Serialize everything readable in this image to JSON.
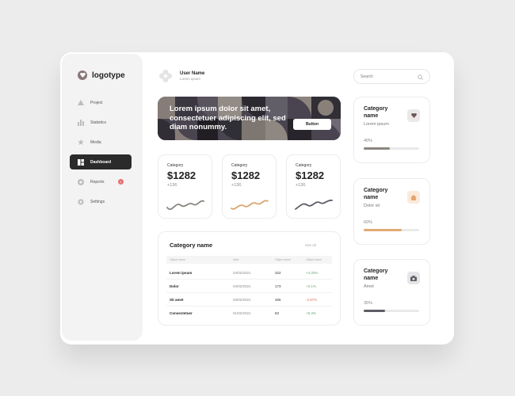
{
  "brand": {
    "logo_text": "logotype"
  },
  "sidebar": {
    "items": [
      {
        "label": "Project",
        "icon": "triangle-icon"
      },
      {
        "label": "Statistics",
        "icon": "bar-chart-icon"
      },
      {
        "label": "Media",
        "icon": "star-icon"
      },
      {
        "label": "Dashboard",
        "icon": "dashboard-icon",
        "active": true
      },
      {
        "label": "Reports",
        "icon": "circle-icon",
        "badge": "1"
      },
      {
        "label": "Settings",
        "icon": "gear-icon"
      }
    ]
  },
  "header": {
    "user_name": "User Name",
    "user_sub": "Lorem ipsum",
    "search_placeholder": "Search"
  },
  "banner": {
    "text": "Lorem ipsum dolor sit amet, consectetuer adipiscing elit, sed diam nonummy.",
    "button_label": "Button"
  },
  "stats": [
    {
      "category": "Category",
      "value": "$1282",
      "delta": "+136",
      "color": "#8a857e"
    },
    {
      "category": "Category",
      "value": "$1282",
      "delta": "+136",
      "color": "#d9a66f"
    },
    {
      "category": "Category",
      "value": "$1282",
      "delta": "+136",
      "color": "#5f5c66"
    }
  ],
  "table": {
    "title": "Category name",
    "see_all": "See all",
    "headers": [
      "Object name",
      "Date",
      "Object name",
      "Object name"
    ],
    "rows": [
      {
        "name": "Lorem ipsum",
        "date": "04/02/2021",
        "num": "322",
        "change": "+4.33%",
        "trend": "up"
      },
      {
        "name": "Dolor",
        "date": "04/02/2021",
        "num": "173",
        "change": "+3.1%",
        "trend": "up"
      },
      {
        "name": "Sit amet",
        "date": "03/02/2021",
        "num": "456",
        "change": "-2.87%",
        "trend": "down"
      },
      {
        "name": "Consectetuer",
        "date": "01/02/2021",
        "num": "83",
        "change": "+5.3%",
        "trend": "up"
      }
    ]
  },
  "right_cards": [
    {
      "title": "Category name",
      "subtitle": "Lorem ipsum",
      "percent_label": "40%",
      "progress": 0.47,
      "icon": "heart-icon",
      "icon_bg": "#ece8e8",
      "icon_color": "#6b5556",
      "fill_color": "#8a857e"
    },
    {
      "title": "Category name",
      "subtitle": "Dolor sit",
      "percent_label": "60%",
      "progress": 0.69,
      "icon": "home-icon",
      "icon_bg": "#fbeadb",
      "icon_color": "#e5a369",
      "fill_color": "#e0aa73"
    },
    {
      "title": "Category name",
      "subtitle": "Amet",
      "percent_label": "35%",
      "progress": 0.39,
      "icon": "camera-icon",
      "icon_bg": "#e5e5e8",
      "icon_color": "#5b5a62",
      "fill_color": "#5f5c66"
    }
  ]
}
